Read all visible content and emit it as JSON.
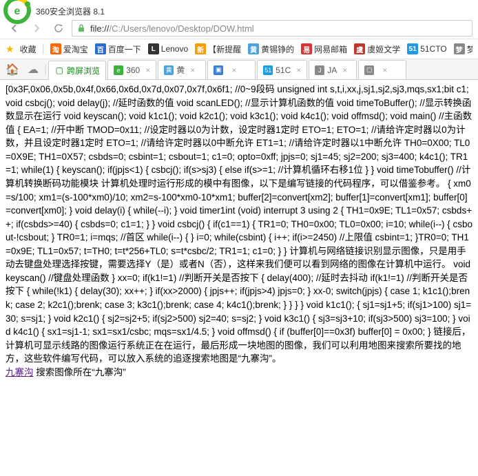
{
  "title": "360安全浏览器 8.1",
  "url": {
    "proto": "file://",
    "path": "/C:/Users/lenovo/Desktop/DOW.html"
  },
  "favbar": {
    "label": "收藏",
    "items": [
      {
        "name": "爱淘宝",
        "bg": "#ff6600",
        "txt": "淘"
      },
      {
        "name": "百度一下",
        "bg": "#2b6cd4",
        "txt": "百"
      },
      {
        "name": "Lenovo",
        "bg": "#333",
        "txt": "L"
      },
      {
        "name": "【新提醒",
        "bg": "#ff9a00",
        "txt": "新"
      },
      {
        "name": "黄锡铮的",
        "bg": "#4aa3df",
        "txt": "黄"
      },
      {
        "name": "网易邮箱",
        "bg": "#d33",
        "txt": "易"
      },
      {
        "name": "虞姬文学",
        "bg": "#c0392b",
        "txt": "虞"
      },
      {
        "name": "51CTO",
        "bg": "#1e9be8",
        "txt": "51"
      },
      {
        "name": "梦",
        "bg": "#888",
        "txt": "梦"
      }
    ]
  },
  "tabs": {
    "kuaping": "跨屏浏览",
    "items": [
      {
        "label": "360",
        "bg": "#3cb33c",
        "txt": "e"
      },
      {
        "label": "黄",
        "bg": "#4aa3df",
        "txt": "黄"
      },
      {
        "label": "",
        "bg": "#3b7dd8",
        "txt": "▣"
      },
      {
        "label": "51C",
        "bg": "#1e9be8",
        "txt": "51"
      },
      {
        "label": "JA",
        "bg": "#888",
        "txt": "J"
      },
      {
        "label": "",
        "bg": "#888",
        "txt": "▢"
      }
    ]
  },
  "body_text": "[0x3F,0x06,0x5b,0x4f,0x66,0x6d,0x7d,0x07,0x7f,0x6f1; //0~9段码 unsigned int s,t,i,xx,j,sj1,sj2,sj3,mqs,sx1;bit c1; void csbcj(); void delay(j); //延时函数的值 void scanLED(); //显示计算机函数的值 void timeToBuffer(); //显示转换函数显示在运行 void keyscan(); void k1c1(); void k2c1(); void k3c1(); void k4c1(); void offmsd(); void main() //主函数值 { EA=1; //开中断 TMOD=0x11; //设定时器以0为计数，设定时器1定时 ETO=1;  ETO=1;  //请给许定时器以0为计数，并且设定时器1定时 ETO=1; //请给许定时器以0中断允许 ET1=1; //请给许定时器以1中断允许 TH0=0X00; TL0=0X9E; TH1=0X57; csbds=0; csbint=1; csbout=1; c1=0; opto=0xff; jpjs=0; sj1=45; sj2=200; sj3=400; k4c1(); TR1=1; while(1) { keyscan(); if(jpjs<1) { csbcj(); if(s>sj3) { else if(s>=1; //计算机循环右移1位 } } void timeTobuffer() //计算机转换断码功能模块 计算机处理时运行形成的模中有图像，以下是编写链接的代码程序，可以借鉴参考。 { xm0=s/100; xm1=(s-100*xm0)/10; xm2=s-100*xm0-10*xm1; buffer[2]=convert[xm2]; buffer[1]=convert[xm1]; buffer[0]=convert[xm0]; } void delay(i) { while(--i); } void timer1int (void) interrupt 3 using 2 { TH1=0x9E; TL1=0x57; csbds++; if(csbds>=40) { csbds=0; c1=1; } } void csbcj() { if(c1==1) { TR1=0; TH0=0x00; TL0=0x00; i=10; while(i--) { csbout-!csbout; } TR0=1; i=mqs; //首区 while(i--) { } i=0; while(csbint) { i++; if(i>=2450) //上限值 csbint=1; }TR0=0; TH1=0x9E; TL1=0x57; t=TH0; t=t*256+TL0; s=t*csbc/2; TR1=1; c1=0; } } 计算机与网络链接识别显示图像，只是用手动去键盘处理选择按键，需要选择Y（是）或者N（否），这样来我们便可以看到网络的图像在计算机中运行。 void keyscan() //键盘处理函数 } xx=0; if(k1!=1) //判断开关是否按下 { delay(400); //延时去抖动 if(k1!=1) //判断开关是否按下 { while(!k1) { delay(30); xx++; } if(xx>2000) { jpjs++; if(jpjs>4) jpjs=0; } xx-0; switch(jpjs) { case 1; k1c1();brenk; case 2; k2c1();brenk; case 3; k3c1();brenk; case 4; k4c1();brenk; } } } } void k1c1(); { sj1=sj1+5; if(sj1>100) sj1=30; s=sj1; } void k2c1() { sj2=sj2+5; if(sj2>500) sj2=40; s=sj2; } void k3c1() { sj3=sj3+10; if(sj3>500) sj3=100; } void k4c1() { sx1=sj1-1; sx1=sx1/csbc; mqs=sx1/4.5; } void offmsd() { if (buffer[0]==0x3f) buffer[0] = 0x00; } 链接后，计算机可显示线路的图像运行系统正在在运行，最后形成一块地图的图像，我们可以利用地图来搜索所要找的地方，这些软件编写代码，可以放入系统的追逐搜索地图是“九寨沟”。",
  "link_text": "九寨沟",
  "tail_text": " 搜索图像所在“九寨沟”"
}
